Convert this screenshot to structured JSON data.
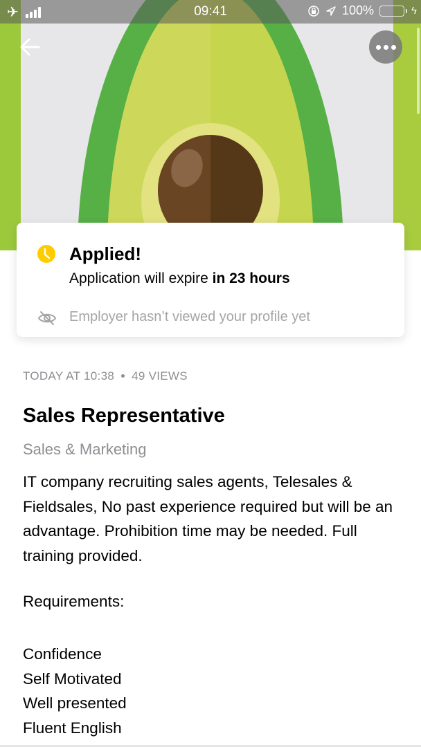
{
  "status_bar": {
    "time": "09:41",
    "battery_percent": "100%",
    "battery_level": 1.0,
    "icons": [
      "airplane-icon",
      "signal-icon",
      "rotation-lock-icon",
      "location-icon",
      "battery-icon",
      "charging-icon"
    ]
  },
  "header": {
    "back_icon": "arrow-left-icon",
    "more_icon": "ellipsis-icon"
  },
  "colors": {
    "accent_yellow": "#ffcc00",
    "muted_text": "#8e8e93",
    "avocado_skin": "#5cb447",
    "avocado_flesh": "#c6d64f",
    "avocado_pit": "#5e3a1a"
  },
  "application_card": {
    "status_icon": "clock-icon",
    "title": "Applied!",
    "expire_prefix": "Application will expire ",
    "expire_highlight": "in 23 hours",
    "viewed_icon": "eye-off-icon",
    "viewed_text": "Employer hasn’t viewed your profile yet"
  },
  "job": {
    "posted": "TODAY AT 10:38",
    "views": "49 VIEWS",
    "title": "Sales Representative",
    "category": "Sales & Marketing",
    "description": "IT company recruiting sales agents, Telesales & Fieldsales, No past experience required but will be an advantage. Prohibition time may be needed. Full training provided.",
    "requirements_label": "Requirements:",
    "requirements": [
      "Confidence",
      "Self Motivated",
      "Well presented",
      "Fluent English"
    ]
  }
}
